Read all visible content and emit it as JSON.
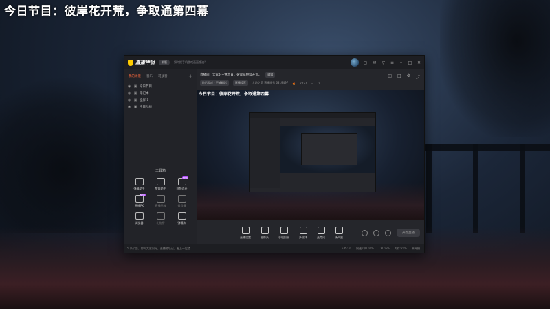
{
  "overlay": {
    "title": "今日节目：彼岸花开荒，争取通第四幕"
  },
  "app": {
    "name": "直播伴侣",
    "version_chip": "新版",
    "tip": "如何把手机游戏画面推流？",
    "titlebar_icons": [
      "avatar",
      "message-icon",
      "mail-icon",
      "gift-icon",
      "menu-icon",
      "minimize-icon",
      "maximize-icon",
      "close-icon"
    ]
  },
  "sidebar": {
    "tabs": [
      {
        "label": "我的场景",
        "active": true
      },
      {
        "label": "音乐",
        "active": false
      },
      {
        "label": "司放音",
        "active": false
      }
    ],
    "add_label": "+",
    "scenes": [
      {
        "label": "今日节目"
      },
      {
        "label": "笔记本"
      },
      {
        "label": "全屏 1"
      },
      {
        "label": "今日战绩"
      }
    ],
    "toolbox_title": "工具箱",
    "tools": [
      {
        "label": "弹幕助手",
        "badge": "",
        "dim": false
      },
      {
        "label": "房管助手",
        "badge": "",
        "dim": false
      },
      {
        "label": "视频连麦",
        "badge": "NEW",
        "dim": false
      },
      {
        "label": "直播PK",
        "badge": "NEW",
        "dim": false
      },
      {
        "label": "直播回放",
        "badge": "",
        "dim": true
      },
      {
        "label": "云导播",
        "badge": "",
        "dim": true
      },
      {
        "label": "浏览器",
        "badge": "",
        "dim": false
      },
      {
        "label": "礼物榜",
        "badge": "",
        "dim": true
      },
      {
        "label": "弹幕库",
        "badge": "",
        "dim": false
      }
    ]
  },
  "info": {
    "greeting": "直播间：大家好~休息日，彼岸花继续开荒。",
    "edit_chip": "编辑",
    "category_chip": "秒后游戏 · 不够精彩",
    "settings_chip": "直播设置",
    "room_id": "大地之塔 直播间号 6819497",
    "viewers": "2727",
    "likes": "0"
  },
  "preview": {
    "title": "今日节目：彼岸花开荒，争取通第四幕"
  },
  "controls": [
    {
      "label": "直播设置",
      "icon": "camera-icon"
    },
    {
      "label": "摄像头",
      "icon": "webcam-icon"
    },
    {
      "label": "手机投屏",
      "icon": "phone-icon"
    },
    {
      "label": "多媒体",
      "icon": "media-icon"
    },
    {
      "label": "麦克风",
      "icon": "mic-icon"
    },
    {
      "label": "扬声器",
      "icon": "speaker-icon"
    }
  ],
  "go_live_label": "开始直播",
  "status": {
    "left": "5 条公告，你向大家问好。直播地址已，更上一层楼",
    "fps": "FPS:30",
    "bitrate": "网速 0/0.00%",
    "cpu": "CPU:6%",
    "mem": "内存:21%",
    "time": "未开播"
  }
}
